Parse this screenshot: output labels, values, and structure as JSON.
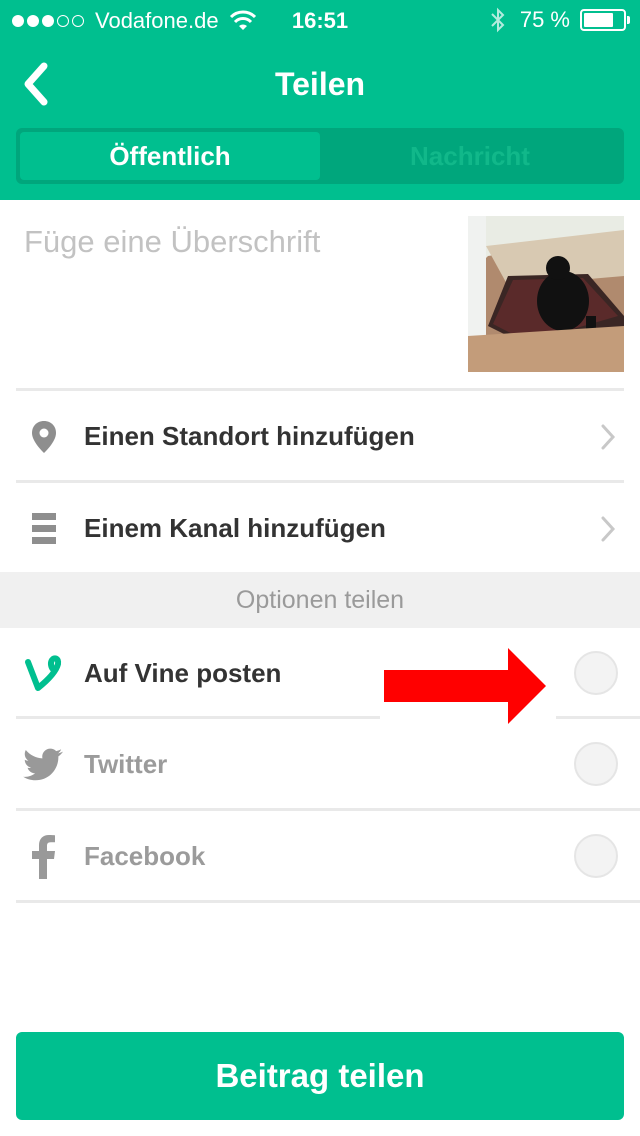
{
  "status_bar": {
    "signal_dots": [
      true,
      true,
      true,
      false,
      false
    ],
    "carrier": "Vodafone.de",
    "time": "16:51",
    "battery_percent": "75 %",
    "battery_level": 0.75
  },
  "nav": {
    "title": "Teilen",
    "back_icon": "chevron-left-icon"
  },
  "tabs": [
    {
      "label": "Öffentlich",
      "active": true
    },
    {
      "label": "Nachricht",
      "active": false
    }
  ],
  "caption": {
    "placeholder": "Füge eine Überschrift",
    "value": ""
  },
  "thumbnail": {
    "icon": "video-thumbnail"
  },
  "options": [
    {
      "label": "Einen Standort hinzufügen",
      "icon": "location-pin-icon"
    },
    {
      "label": "Einem Kanal hinzufügen",
      "icon": "channel-list-icon"
    }
  ],
  "share_section": {
    "header": "Optionen teilen",
    "items": [
      {
        "label": "Auf Vine posten",
        "icon": "vine-icon",
        "enabled": true,
        "selected": false
      },
      {
        "label": "Twitter",
        "icon": "twitter-icon",
        "enabled": false,
        "selected": false
      },
      {
        "label": "Facebook",
        "icon": "facebook-icon",
        "enabled": false,
        "selected": false
      }
    ]
  },
  "annotation": {
    "icon": "red-arrow-right"
  },
  "share_button": {
    "label": "Beitrag teilen"
  },
  "colors": {
    "brand_green": "#00bf8f",
    "segment_dark": "#00a67c",
    "annotation_red": "#ff0000",
    "text_dark": "#333333",
    "text_muted": "#9b9b9b"
  }
}
